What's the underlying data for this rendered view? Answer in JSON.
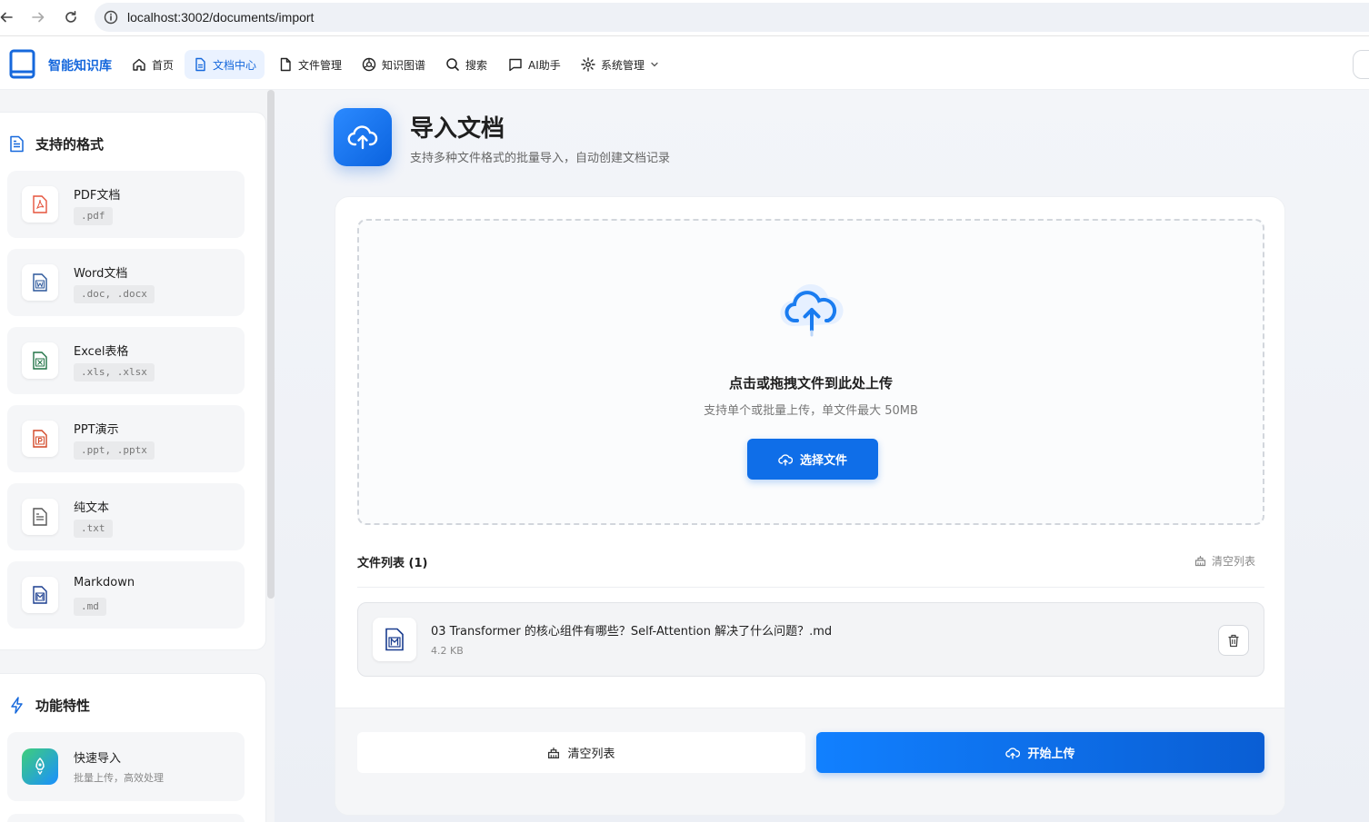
{
  "browser": {
    "url": "localhost:3002/documents/import"
  },
  "header": {
    "brand": "智能知识库",
    "nav": [
      {
        "label": "首页",
        "icon": "home-icon"
      },
      {
        "label": "文档中心",
        "icon": "document-icon",
        "active": true
      },
      {
        "label": "文件管理",
        "icon": "file-icon"
      },
      {
        "label": "知识图谱",
        "icon": "graph-icon"
      },
      {
        "label": "搜索",
        "icon": "search-icon"
      },
      {
        "label": "AI助手",
        "icon": "chat-icon"
      },
      {
        "label": "系统管理",
        "icon": "settings-icon"
      }
    ]
  },
  "sidebar": {
    "formats_title": "支持的格式",
    "formats": [
      {
        "name": "PDF文档",
        "ext": ".pdf",
        "color": "#e5533c",
        "icon": "pdf-file-icon"
      },
      {
        "name": "Word文档",
        "ext": ".doc, .docx",
        "color": "#2b579a",
        "icon": "word-file-icon"
      },
      {
        "name": "Excel表格",
        "ext": ".xls, .xlsx",
        "color": "#217346",
        "icon": "excel-file-icon"
      },
      {
        "name": "PPT演示",
        "ext": ".ppt, .pptx",
        "color": "#d24726",
        "icon": "ppt-file-icon"
      },
      {
        "name": "纯文本",
        "ext": ".txt",
        "color": "#555555",
        "icon": "text-file-icon"
      },
      {
        "name": "Markdown",
        "ext": ".md",
        "color": "#1a3d8f",
        "icon": "markdown-file-icon"
      }
    ],
    "features_title": "功能特性",
    "features": [
      {
        "name": "快速导入",
        "desc": "批量上传，高效处理",
        "icon": "rocket-icon"
      }
    ]
  },
  "main": {
    "title": "导入文档",
    "subtitle": "支持多种文件格式的批量导入，自动创建文档记录",
    "dropzone": {
      "title": "点击或拖拽文件到此处上传",
      "hint": "支持单个或批量上传，单文件最大 50MB",
      "button": "选择文件"
    },
    "file_list": {
      "title": "文件列表 (1)",
      "clear": "清空列表",
      "files": [
        {
          "name": "03 Transformer 的核心组件有哪些？Self-Attention 解决了什么问题？.md",
          "size": "4.2 KB"
        }
      ]
    },
    "footer": {
      "clear": "清空列表",
      "upload": "开始上传"
    }
  },
  "colors": {
    "accent": "#1668dc",
    "primary_button": "#0f6ee8"
  }
}
